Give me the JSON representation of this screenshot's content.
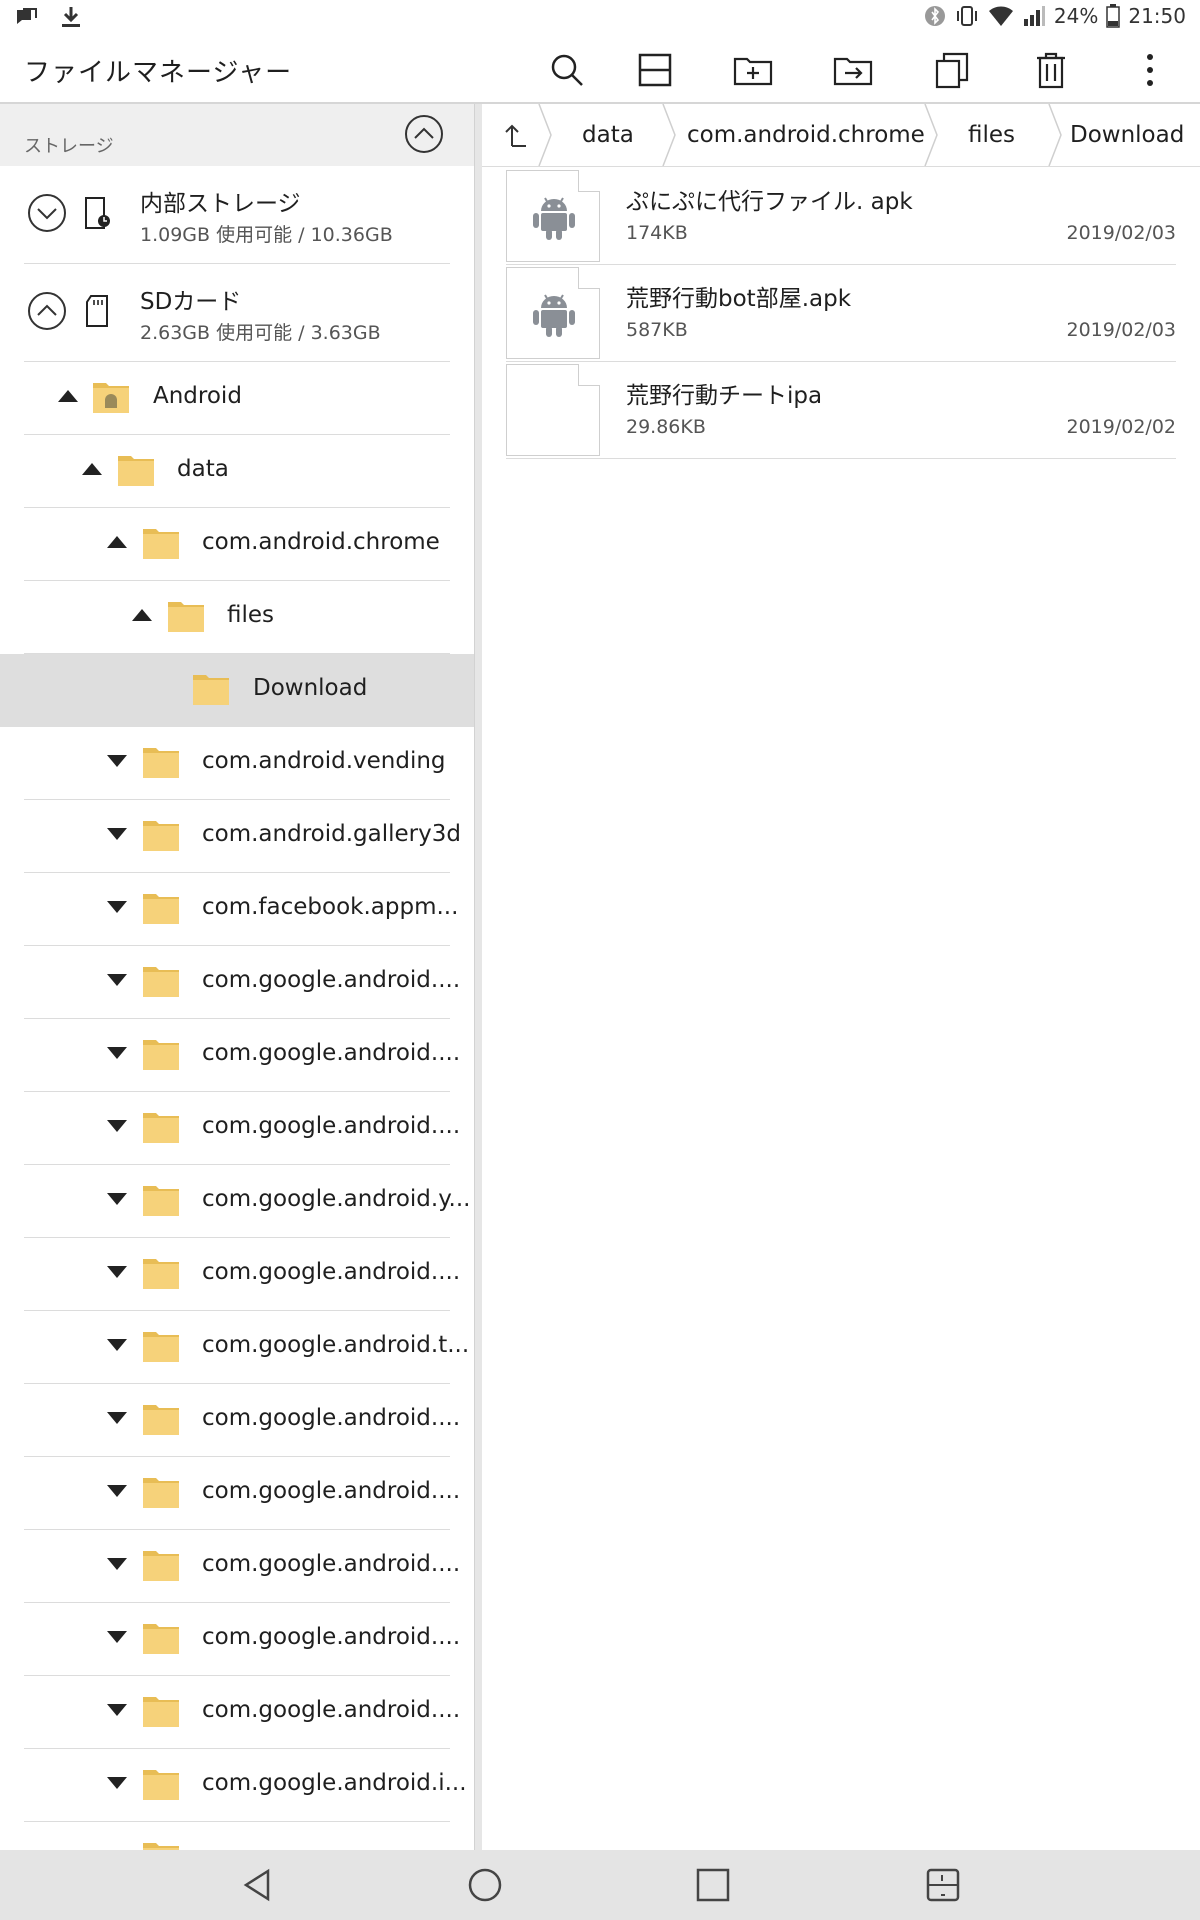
{
  "status_bar": {
    "battery": "24%",
    "time": "21:50"
  },
  "app_bar": {
    "title": "ファイルマネージャー",
    "actions": [
      "search-icon",
      "split-view-icon",
      "new-folder-icon",
      "move-icon",
      "copy-icon",
      "delete-icon",
      "more-icon"
    ]
  },
  "left_pane": {
    "section_label": "ストレージ",
    "volumes": [
      {
        "name": "内部ストレージ",
        "info": "1.09GB 使用可能 / 10.36GB",
        "expanded": false
      },
      {
        "name": "SDカード",
        "info": "2.63GB 使用可能 / 3.63GB",
        "expanded": true
      }
    ],
    "tree": [
      {
        "label": "Android",
        "depth": 0,
        "state": "expanded",
        "icon": "android-folder-icon"
      },
      {
        "label": "data",
        "depth": 1,
        "state": "expanded",
        "icon": "folder-icon"
      },
      {
        "label": "com.android.chrome",
        "depth": 2,
        "state": "expanded",
        "icon": "folder-icon"
      },
      {
        "label": "files",
        "depth": 3,
        "state": "expanded",
        "icon": "folder-icon"
      },
      {
        "label": "Download",
        "depth": 4,
        "state": "selected",
        "icon": "folder-icon"
      },
      {
        "label": "com.android.vending",
        "depth": 2,
        "state": "collapsed",
        "icon": "folder-icon"
      },
      {
        "label": "com.android.gallery3d",
        "depth": 2,
        "state": "collapsed",
        "icon": "folder-icon"
      },
      {
        "label": "com.facebook.appm...",
        "depth": 2,
        "state": "collapsed",
        "icon": "folder-icon"
      },
      {
        "label": "com.google.android....",
        "depth": 2,
        "state": "collapsed",
        "icon": "folder-icon"
      },
      {
        "label": "com.google.android....",
        "depth": 2,
        "state": "collapsed",
        "icon": "folder-icon"
      },
      {
        "label": "com.google.android....",
        "depth": 2,
        "state": "collapsed",
        "icon": "folder-icon"
      },
      {
        "label": "com.google.android.y...",
        "depth": 2,
        "state": "collapsed",
        "icon": "folder-icon"
      },
      {
        "label": "com.google.android....",
        "depth": 2,
        "state": "collapsed",
        "icon": "folder-icon"
      },
      {
        "label": "com.google.android.t...",
        "depth": 2,
        "state": "collapsed",
        "icon": "folder-icon"
      },
      {
        "label": "com.google.android....",
        "depth": 2,
        "state": "collapsed",
        "icon": "folder-icon"
      },
      {
        "label": "com.google.android....",
        "depth": 2,
        "state": "collapsed",
        "icon": "folder-icon"
      },
      {
        "label": "com.google.android....",
        "depth": 2,
        "state": "collapsed",
        "icon": "folder-icon"
      },
      {
        "label": "com.google.android....",
        "depth": 2,
        "state": "collapsed",
        "icon": "folder-icon"
      },
      {
        "label": "com.google.android....",
        "depth": 2,
        "state": "collapsed",
        "icon": "folder-icon"
      },
      {
        "label": "com.google.android.i...",
        "depth": 2,
        "state": "collapsed",
        "icon": "folder-icon"
      },
      {
        "label": "",
        "depth": 2,
        "state": "collapsed",
        "icon": "folder-icon"
      }
    ]
  },
  "right_pane": {
    "breadcrumb": [
      "data",
      "com.android.chrome",
      "files",
      "Download"
    ],
    "files": [
      {
        "name": "ぷにぷに代行ファイル. apk",
        "size": "174KB",
        "date": "2019/02/03",
        "icon": "android-apk-icon"
      },
      {
        "name": "荒野行動bot部屋.apk",
        "size": "587KB",
        "date": "2019/02/03",
        "icon": "android-apk-icon"
      },
      {
        "name": "荒野行動チートipa",
        "size": "29.86KB",
        "date": "2019/02/02",
        "icon": "generic-file-icon"
      }
    ]
  },
  "colors": {
    "folder": "#f6d27a",
    "folder_dark": "#e8bd55",
    "selected_row": "#dedede",
    "android_gray": "#8a8f96",
    "nav_bar": "#e4e4e4"
  }
}
